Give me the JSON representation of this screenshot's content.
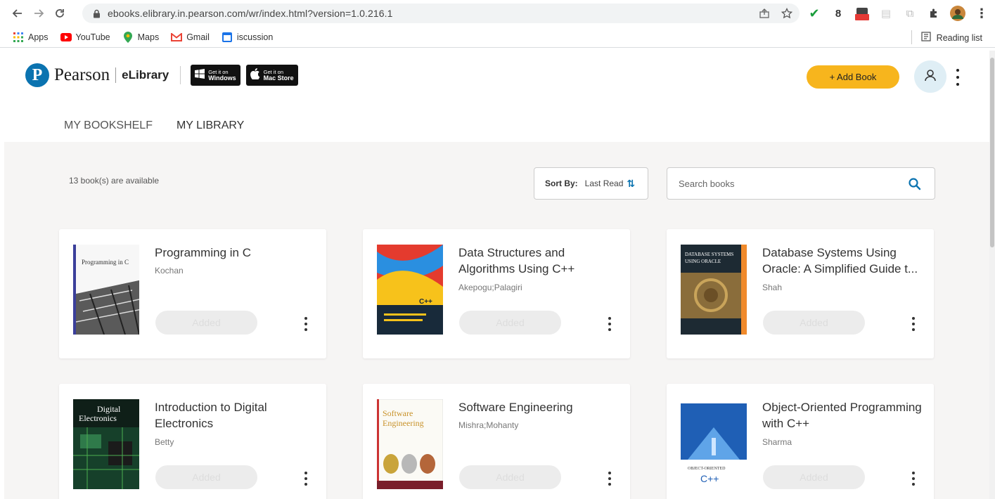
{
  "browser": {
    "url": "ebooks.elibrary.in.pearson.com/wr/index.html?version=1.0.216.1",
    "bookmarks": [
      {
        "label": "Apps",
        "icon": "apps-grid-icon"
      },
      {
        "label": "YouTube",
        "icon": "youtube-icon"
      },
      {
        "label": "Maps",
        "icon": "maps-pin-icon"
      },
      {
        "label": "Gmail",
        "icon": "gmail-icon"
      },
      {
        "label": "iscussion",
        "icon": "calendar-icon"
      }
    ],
    "reading_list": "Reading list",
    "extension_badge": "new"
  },
  "header": {
    "brand": "Pearson",
    "sub_brand": "eLibrary",
    "store_windows": {
      "small": "Get it on",
      "big": "Windows"
    },
    "store_mac": {
      "small": "Get it on",
      "big": "Mac Store"
    },
    "add_book": "+ Add Book"
  },
  "tabs": [
    {
      "label": "MY BOOKSHELF",
      "active": false
    },
    {
      "label": "MY LIBRARY",
      "active": true
    }
  ],
  "toolbar": {
    "count": "13 book(s) are available",
    "sort_label": "Sort By:",
    "sort_value": "Last Read",
    "search_placeholder": "Search books"
  },
  "books": [
    {
      "title": "Programming in C",
      "author": "Kochan",
      "status": "Added",
      "cover_text": "Programming in C"
    },
    {
      "title": "Data Structures and Algorithms Using C++",
      "author": "Akepogu;Palagiri",
      "status": "Added",
      "cover_text": "C++"
    },
    {
      "title": "Database Systems Using Oracle: A Simplified Guide t...",
      "author": "Shah",
      "status": "Added",
      "cover_text": "Database Systems Using Oracle"
    },
    {
      "title": "Introduction to Digital Electronics",
      "author": "Betty",
      "status": "Added",
      "cover_text": "Digital Electronics"
    },
    {
      "title": "Software Engineering",
      "author": "Mishra;Mohanty",
      "status": "Added",
      "cover_text": "Software Engineering"
    },
    {
      "title": "Object-Oriented Programming with C++",
      "author": "Sharma",
      "status": "Added",
      "cover_text": "C++"
    }
  ],
  "colors": {
    "accent": "#f7b51d",
    "brand_blue": "#0b73b0",
    "background": "#f6f5f4"
  }
}
